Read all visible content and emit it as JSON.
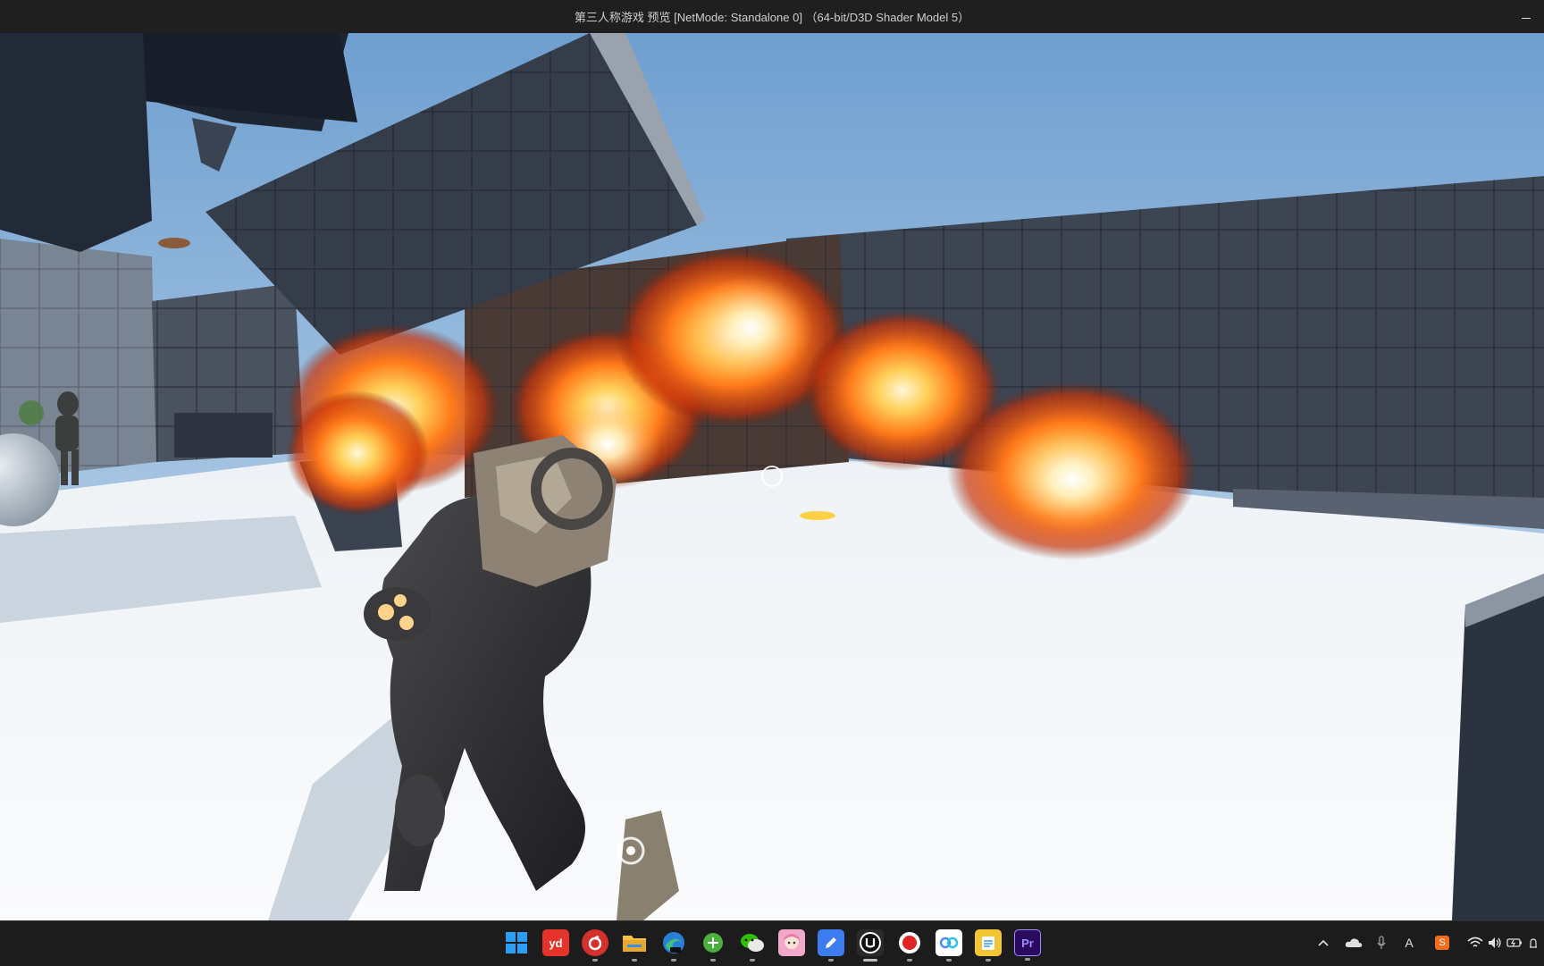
{
  "window": {
    "title": "第三人称游戏 预览 [NetMode: Standalone 0] （64-bit/D3D Shader Model 5）",
    "minimize_icon": "minimize-icon"
  },
  "scene": {
    "description_icons": [
      "crosshair-icon",
      "interaction-marker-icon"
    ],
    "colors": {
      "sky_top": "#6f9fd0",
      "sky_bottom": "#cfe1ef",
      "floor": "#f4f6f8",
      "walls": "#3a4150",
      "fire": "#ff7a1a"
    }
  },
  "taskbar": {
    "apps": [
      {
        "name": "start",
        "icon": "windows-start-icon",
        "label": "",
        "color": "#2a9df4"
      },
      {
        "name": "youdao",
        "icon": "youdao-dict-icon",
        "label": "yd",
        "color": "#e6332a"
      },
      {
        "name": "netease-music",
        "icon": "netease-music-icon",
        "label": "",
        "color": "#d4302c"
      },
      {
        "name": "file-explorer",
        "icon": "folder-icon",
        "label": "",
        "color": "#f5c242"
      },
      {
        "name": "edge-dev",
        "icon": "edge-dev-icon",
        "label": "",
        "color": "#2aa37a"
      },
      {
        "name": "green-app",
        "icon": "green-circle-app-icon",
        "label": "",
        "color": "#4cae3c"
      },
      {
        "name": "wechat",
        "icon": "wechat-icon",
        "label": "",
        "color": "#2dc100"
      },
      {
        "name": "anime-app",
        "icon": "anime-avatar-icon",
        "label": "",
        "color": "#f2a9c9"
      },
      {
        "name": "editor-app",
        "icon": "blue-pen-app-icon",
        "label": "",
        "color": "#3d7bf0"
      },
      {
        "name": "unreal-engine",
        "icon": "unreal-engine-icon",
        "label": "",
        "color": "#111111"
      },
      {
        "name": "recorder",
        "icon": "record-icon",
        "label": "",
        "color": "#e22424"
      },
      {
        "name": "baidu-netdisk",
        "icon": "baidu-netdisk-icon",
        "label": "",
        "color": "#4b8ef6"
      },
      {
        "name": "notes-app",
        "icon": "notes-app-icon",
        "label": "",
        "color": "#f3c535"
      },
      {
        "name": "premiere-pro",
        "icon": "premiere-pro-icon",
        "label": "Pr",
        "color": "#2a0a5e"
      }
    ],
    "tray": {
      "chevron_icon": "chevron-up-icon",
      "cloud_icon": "onedrive-cloud-icon",
      "mic_icon": "microphone-icon",
      "ime_label": "A",
      "sogou_label": "S",
      "wifi_icon": "wifi-icon",
      "volume_icon": "speaker-icon",
      "battery_icon": "battery-charging-icon",
      "notification_icon": "notification-icon"
    }
  }
}
